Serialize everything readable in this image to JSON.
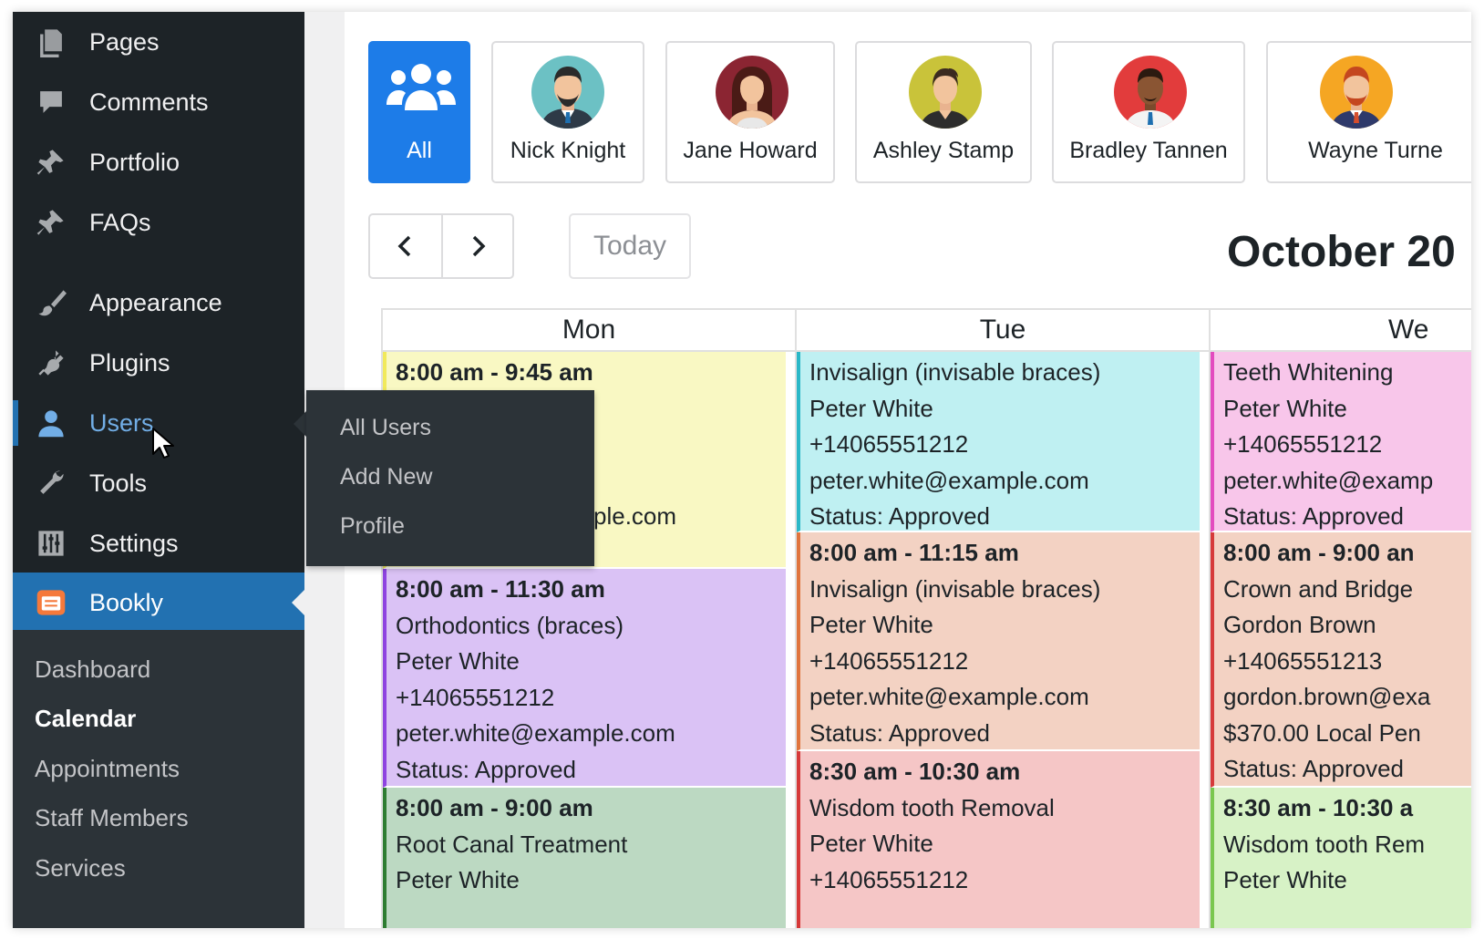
{
  "sidebar": {
    "items": [
      {
        "label": "Pages",
        "icon": "pages-icon"
      },
      {
        "label": "Comments",
        "icon": "comment-bubble-icon"
      },
      {
        "label": "Portfolio",
        "icon": "pushpin-icon"
      },
      {
        "label": "FAQs",
        "icon": "pushpin-icon"
      },
      {
        "label": "Appearance",
        "icon": "paintbrush-icon"
      },
      {
        "label": "Plugins",
        "icon": "plug-icon"
      },
      {
        "label": "Users",
        "icon": "user-icon"
      },
      {
        "label": "Tools",
        "icon": "wrench-icon"
      },
      {
        "label": "Settings",
        "icon": "sliders-icon"
      },
      {
        "label": "Bookly",
        "icon": "bookly-logo-icon"
      }
    ],
    "bookly_submenu": [
      "Dashboard",
      "Calendar",
      "Appointments",
      "Staff Members",
      "Services"
    ],
    "users_flyout": [
      "All Users",
      "Add New",
      "Profile"
    ],
    "active_color": "#2271b1",
    "hover_color": "#72aee6"
  },
  "staff": {
    "all_label": "All",
    "members": [
      "Nick Knight",
      "Jane Howard",
      "Ashley Stamp",
      "Bradley Tannen",
      "Wayne Turne"
    ]
  },
  "toolbar": {
    "prev_icon": "chevron-left-icon",
    "next_icon": "chevron-right-icon",
    "today_label": "Today",
    "title": "October 20"
  },
  "calendar": {
    "days": [
      "Mon",
      "Tue",
      "We"
    ],
    "events": {
      "mon": [
        {
          "lines": [
            "8:00 am - 9:45 am",
            "",
            "",
            "",
            "ple.com"
          ],
          "color": "#f9f8c3",
          "border": "#f1e95c"
        },
        {
          "lines": [
            "8:00 am - 11:30 am",
            "Orthodontics (braces)",
            "Peter White",
            "+14065551212",
            "peter.white@example.com",
            "Status: Approved"
          ],
          "color": "#dac2f5",
          "border": "#8e44e0"
        },
        {
          "lines": [
            "8:00 am - 9:00 am",
            "Root Canal Treatment",
            "Peter White"
          ],
          "color": "#bcd9c2",
          "border": "#2e7d32"
        }
      ],
      "tue": [
        {
          "lines": [
            "Invisalign (invisable braces)",
            "Peter White",
            "+14065551212",
            "peter.white@example.com",
            "Status: Approved"
          ],
          "color": "#bff0f2",
          "border": "#2ab7c7"
        },
        {
          "lines": [
            "8:00 am - 11:15 am",
            "Invisalign (invisable braces)",
            "Peter White",
            "+14065551212",
            "peter.white@example.com",
            "Status: Approved"
          ],
          "color": "#f3d2c3",
          "border": "#e0743d"
        },
        {
          "lines": [
            "8:30 am - 10:30 am",
            "Wisdom tooth Removal",
            "Peter White",
            "+14065551212"
          ],
          "color": "#f5c6c6",
          "border": "#d63a3a"
        }
      ],
      "wed": [
        {
          "lines": [
            "Teeth Whitening",
            "Peter White",
            "+14065551212",
            "peter.white@examp",
            "Status: Approved"
          ],
          "color": "#f8c6ea",
          "border": "#e34bbf"
        },
        {
          "lines": [
            "8:00 am - 9:00 an",
            "Crown and Bridge",
            "Gordon Brown",
            "+14065551213",
            "gordon.brown@exa",
            "$370.00 Local Pen",
            "Status: Approved"
          ],
          "color": "#f3d2c3",
          "border": "#d63a3a"
        },
        {
          "lines": [
            "8:30 am - 10:30 a",
            "Wisdom tooth Rem",
            "Peter White"
          ],
          "color": "#d7f2c6",
          "border": "#7ac74f"
        }
      ]
    }
  }
}
